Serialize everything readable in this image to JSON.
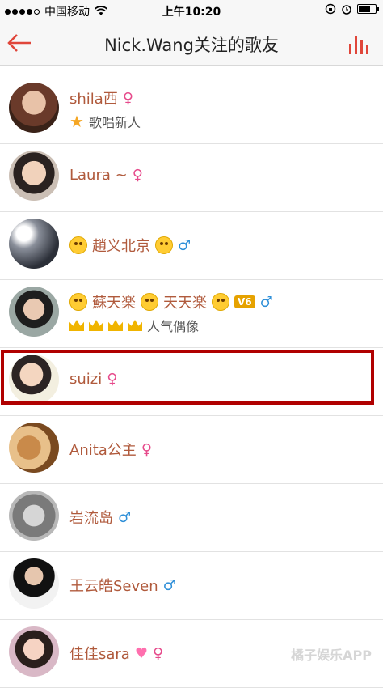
{
  "status_bar": {
    "carrier": "中国移动",
    "time": "上午10:20"
  },
  "nav": {
    "title": "Nick.Wang关注的歌友"
  },
  "users": [
    {
      "name": "shila西",
      "gender": "female",
      "badge_icon": "star-icon",
      "badge_text": "歌唱新人"
    },
    {
      "name": "Laura ~",
      "gender": "female"
    },
    {
      "name": "趙义北京",
      "gender": "male"
    },
    {
      "name": "蘇天楽",
      "name2": "天天楽",
      "vip_badge": "V6",
      "gender": "male",
      "badge_icon": "crown-icon",
      "badge_text": "人气偶像"
    },
    {
      "name": "suizi",
      "gender": "female"
    },
    {
      "name": "Anita公主",
      "gender": "female"
    },
    {
      "name": "岩流岛",
      "gender": "male"
    },
    {
      "name": "王云皓Seven",
      "gender": "male"
    },
    {
      "name": "佳佳sara",
      "gender": "female"
    }
  ],
  "gender_symbols": {
    "female": "♀",
    "male": "♂"
  },
  "watermark": "橘子娱乐APP",
  "colors": {
    "name": "#b05a3c",
    "female": "#e64a8b",
    "male": "#2e8fd8",
    "highlight": "#b00000",
    "accent": "#e0463a"
  }
}
